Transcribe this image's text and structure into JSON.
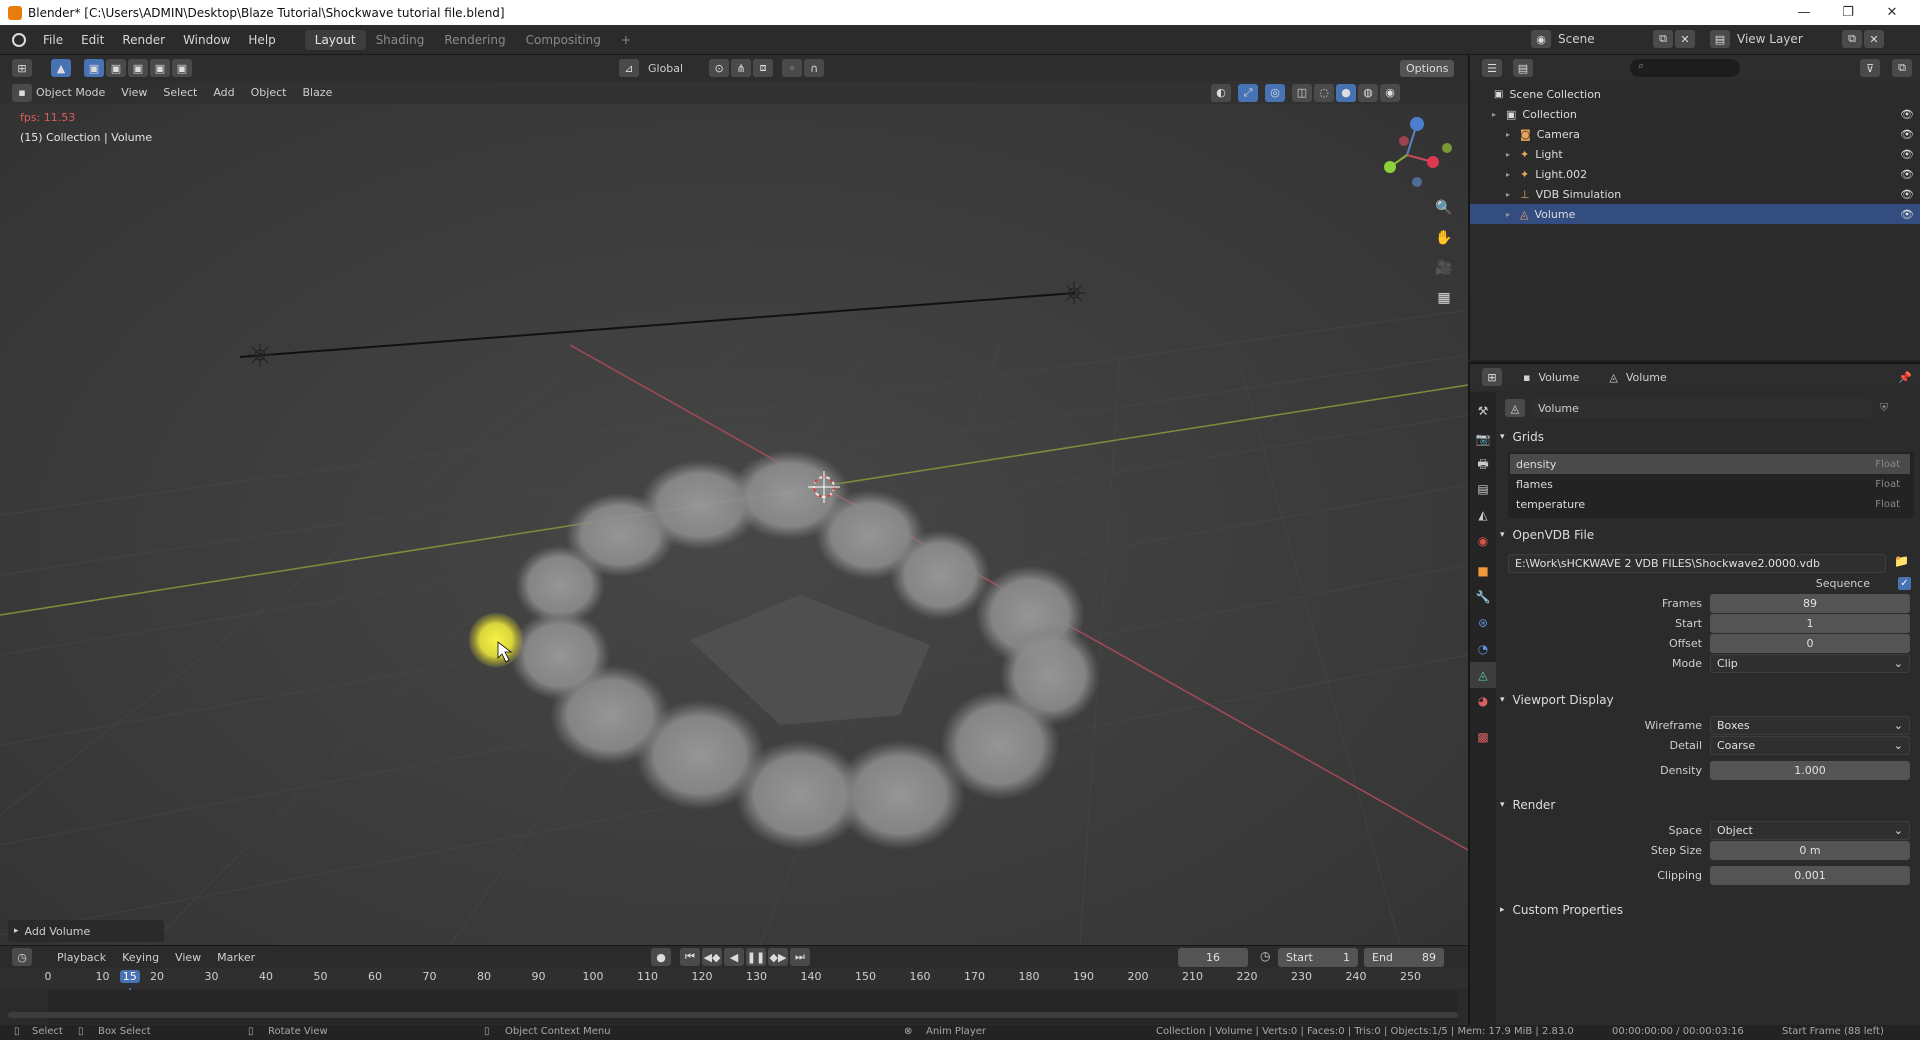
{
  "window": {
    "title": "Blender* [C:\\Users\\ADMIN\\Desktop\\Blaze Tutorial\\Shockwave tutorial file.blend]",
    "min": "—",
    "max": "❐",
    "close": "✕"
  },
  "menus": [
    "File",
    "Edit",
    "Render",
    "Window",
    "Help"
  ],
  "workspaces": [
    "Layout",
    "Shading",
    "Rendering",
    "Compositing"
  ],
  "workspace_add": "+",
  "scene": {
    "name": "Scene",
    "view_layer": "View Layer"
  },
  "viewport": {
    "mode": "Object Mode",
    "menus": [
      "View",
      "Select",
      "Add",
      "Object",
      "Blaze"
    ],
    "transform": "Global",
    "options": "Options",
    "fps": "fps: 11.53",
    "object_info": "(15) Collection | Volume",
    "last_op": "Add Volume"
  },
  "outliner": {
    "root": "Scene Collection",
    "items": [
      {
        "label": "Collection",
        "indent": 1,
        "selected": false,
        "icon": "collection-icon"
      },
      {
        "label": "Camera",
        "indent": 2,
        "selected": false,
        "icon": "camera-icon"
      },
      {
        "label": "Light",
        "indent": 2,
        "selected": false,
        "icon": "light-icon"
      },
      {
        "label": "Light.002",
        "indent": 2,
        "selected": false,
        "icon": "light-icon"
      },
      {
        "label": "VDB Simulation",
        "indent": 2,
        "selected": false,
        "icon": "empty-icon"
      },
      {
        "label": "Volume",
        "indent": 2,
        "selected": true,
        "icon": "volume-icon"
      }
    ]
  },
  "properties": {
    "breadcrumb_object": "Volume",
    "breadcrumb_data": "Volume",
    "datablock": "Volume",
    "grids": {
      "title": "Grids",
      "rows": [
        {
          "name": "density",
          "type": "Float",
          "active": true
        },
        {
          "name": "flames",
          "type": "Float",
          "active": false
        },
        {
          "name": "temperature",
          "type": "Float",
          "active": false
        }
      ]
    },
    "openvdb": {
      "title": "OpenVDB File",
      "path": "E:\\Work\\sHCKWAVE 2 VDB FILES\\Shockwave2.0000.vdb",
      "sequence_label": "Sequence",
      "frames_label": "Frames",
      "frames": "89",
      "start_label": "Start",
      "start": "1",
      "offset_label": "Offset",
      "offset": "0",
      "mode_label": "Mode",
      "mode": "Clip"
    },
    "viewport_display": {
      "title": "Viewport Display",
      "wireframe_label": "Wireframe",
      "wireframe": "Boxes",
      "detail_label": "Detail",
      "detail": "Coarse",
      "density_label": "Density",
      "density": "1.000"
    },
    "render": {
      "title": "Render",
      "space_label": "Space",
      "space": "Object",
      "step_label": "Step Size",
      "step": "0 m",
      "clip_label": "Clipping",
      "clip": "0.001"
    },
    "custom": {
      "title": "Custom Properties"
    }
  },
  "timeline": {
    "menus": [
      "Playback",
      "Keying",
      "View",
      "Marker"
    ],
    "current_frame": "16",
    "start_label": "Start",
    "start": "1",
    "end_label": "End",
    "end": "89",
    "ruler": [
      "0",
      "10",
      "15",
      "20",
      "30",
      "40",
      "50",
      "60",
      "70",
      "80",
      "90",
      "100",
      "110",
      "120",
      "130",
      "140",
      "150",
      "160",
      "170",
      "180",
      "190",
      "200",
      "210",
      "220",
      "230",
      "240",
      "250"
    ],
    "ruler_frames": [
      0,
      10,
      15,
      20,
      30,
      40,
      50,
      60,
      70,
      80,
      90,
      100,
      110,
      120,
      130,
      140,
      150,
      160,
      170,
      180,
      190,
      200,
      210,
      220,
      230,
      240,
      250
    ],
    "playhead": "15"
  },
  "status": {
    "select": "Select",
    "box": "Box Select",
    "rotate": "Rotate View",
    "context": "Object Context Menu",
    "player": "Anim Player",
    "stats": "Collection | Volume | Verts:0 | Faces:0 | Tris:0 | Objects:1/5 | Mem: 17.9 MiB | 2.83.0",
    "time": "00:00:00:00 / 00:00:03:16",
    "startframe": "Start Frame (88 left)"
  }
}
